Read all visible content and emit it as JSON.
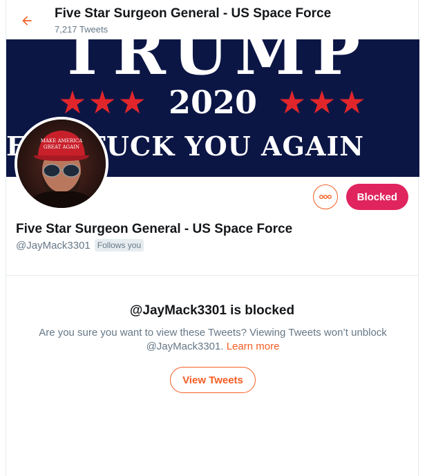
{
  "header": {
    "back_icon": "arrow-left-icon",
    "title": "Five Star Surgeon General - US Space Force",
    "tweet_count": "7,217 Tweets"
  },
  "banner": {
    "top_text": "TRUMP",
    "stars_left": "★★★",
    "year": "2020",
    "stars_right": "★★★",
    "slogan": "E  SE FUCK YOU AGAIN"
  },
  "avatar": {
    "hat_text_line1": "MAKE AMERICA",
    "hat_text_line2": "GREAT AGAIN"
  },
  "actions": {
    "more_icon": "more-horizontal-icon",
    "blocked_label": "Blocked"
  },
  "profile": {
    "name": "Five Star Surgeon General - US Space Force",
    "handle": "@JayMack3301",
    "follows_you": "Follows you"
  },
  "blocked_notice": {
    "title": "@JayMack3301 is blocked",
    "message_part1": "Are you sure you want to view these Tweets? Viewing Tweets won’t unblock @JayMack3301.",
    "learn_more": "Learn more",
    "view_button": "View Tweets"
  },
  "colors": {
    "accent": "#f45d22",
    "blocked": "#e0245e",
    "banner_bg": "#0c1645",
    "star_red": "#e0262b"
  }
}
